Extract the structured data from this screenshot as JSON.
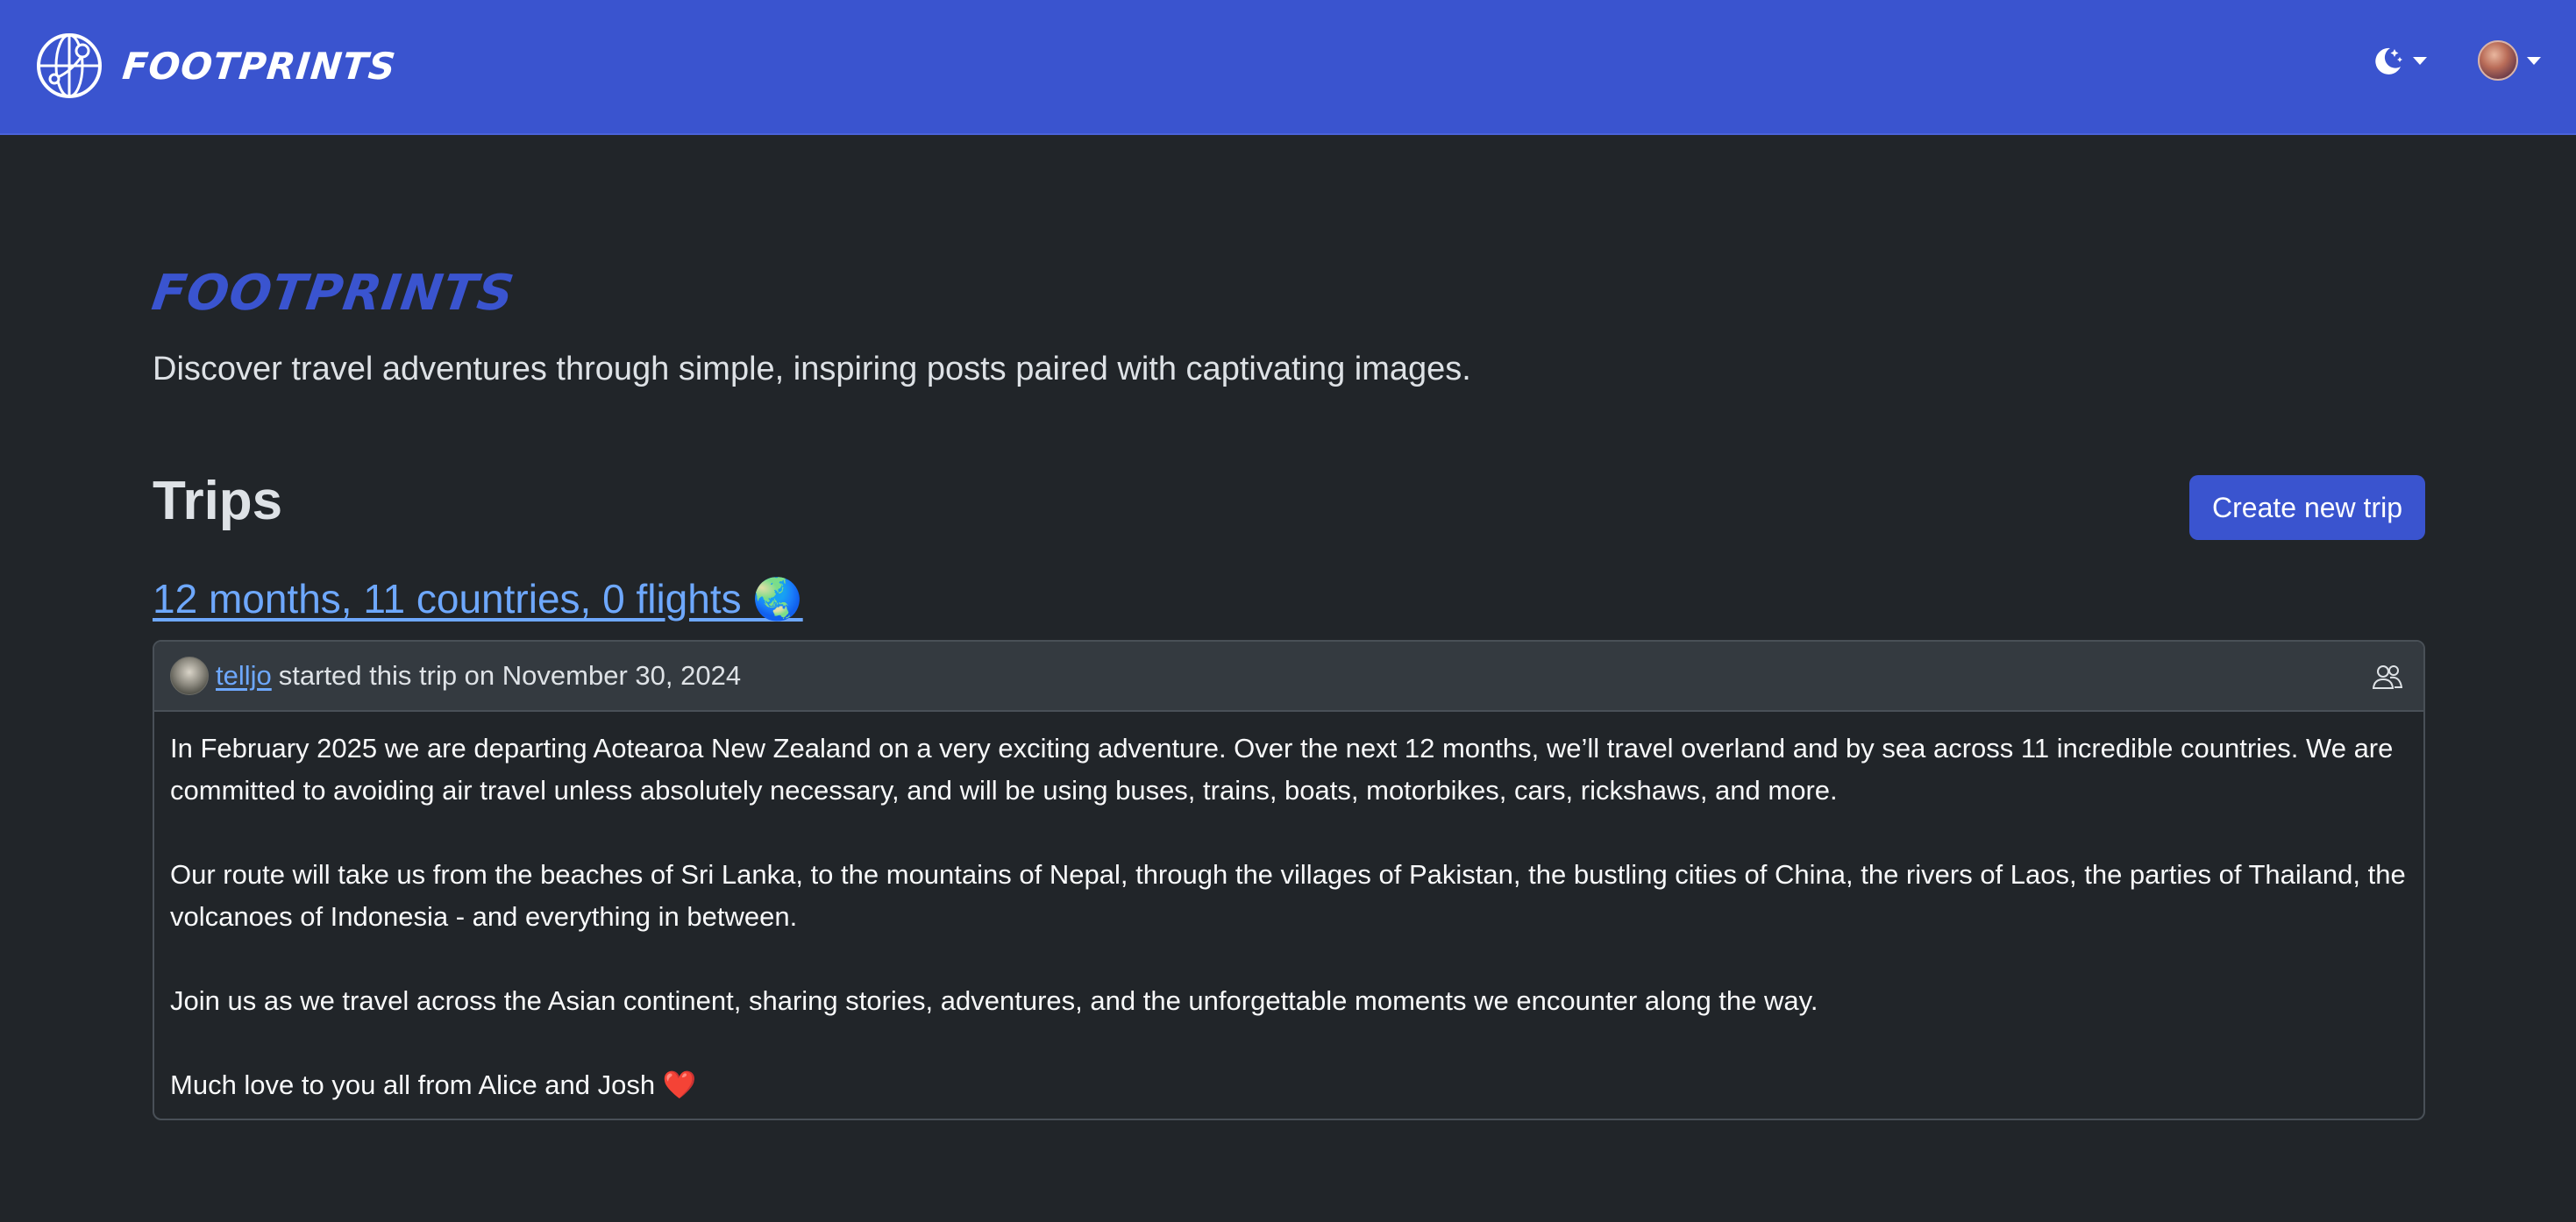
{
  "navbar": {
    "brand": "FOOTPRINTS",
    "icons": {
      "logo": "globe-route-icon",
      "theme": "moon-stars-icon",
      "user": "avatar"
    }
  },
  "hero": {
    "title": "FOOTPRINTS",
    "subtitle": "Discover travel adventures through simple, inspiring posts paired with captivating images."
  },
  "trips": {
    "heading": "Trips",
    "create_button": "Create new trip",
    "items": [
      {
        "title": "12 months, 11 countries, 0 flights 🌏",
        "author": "telljo",
        "meta": "started this trip on November 30, 2024",
        "paragraphs": [
          "In February 2025 we are departing Aotearoa New Zealand on a very exciting adventure. Over the next 12 months, we’ll travel overland and by sea across 11 incredible countries. We are committed to avoiding air travel unless absolutely necessary, and will be using buses, trains, boats, motorbikes, cars, rickshaws, and more.",
          "Our route will take us from the beaches of Sri Lanka, to the mountains of Nepal, through the villages of Pakistan, the bustling cities of China, the rivers of Laos, the parties of Thailand, the volcanoes of Indonesia - and everything in between.",
          "Join us as we travel across the Asian continent, sharing stories, adventures, and the unforgettable moments we encounter along the way."
        ],
        "signoff": "Much love to you all from Alice and Josh",
        "signoff_emoji": "❤️"
      }
    ]
  },
  "colors": {
    "primary": "#3a54cf",
    "background": "#212529",
    "link": "#6ea8fe",
    "card_header": "#343a40"
  }
}
